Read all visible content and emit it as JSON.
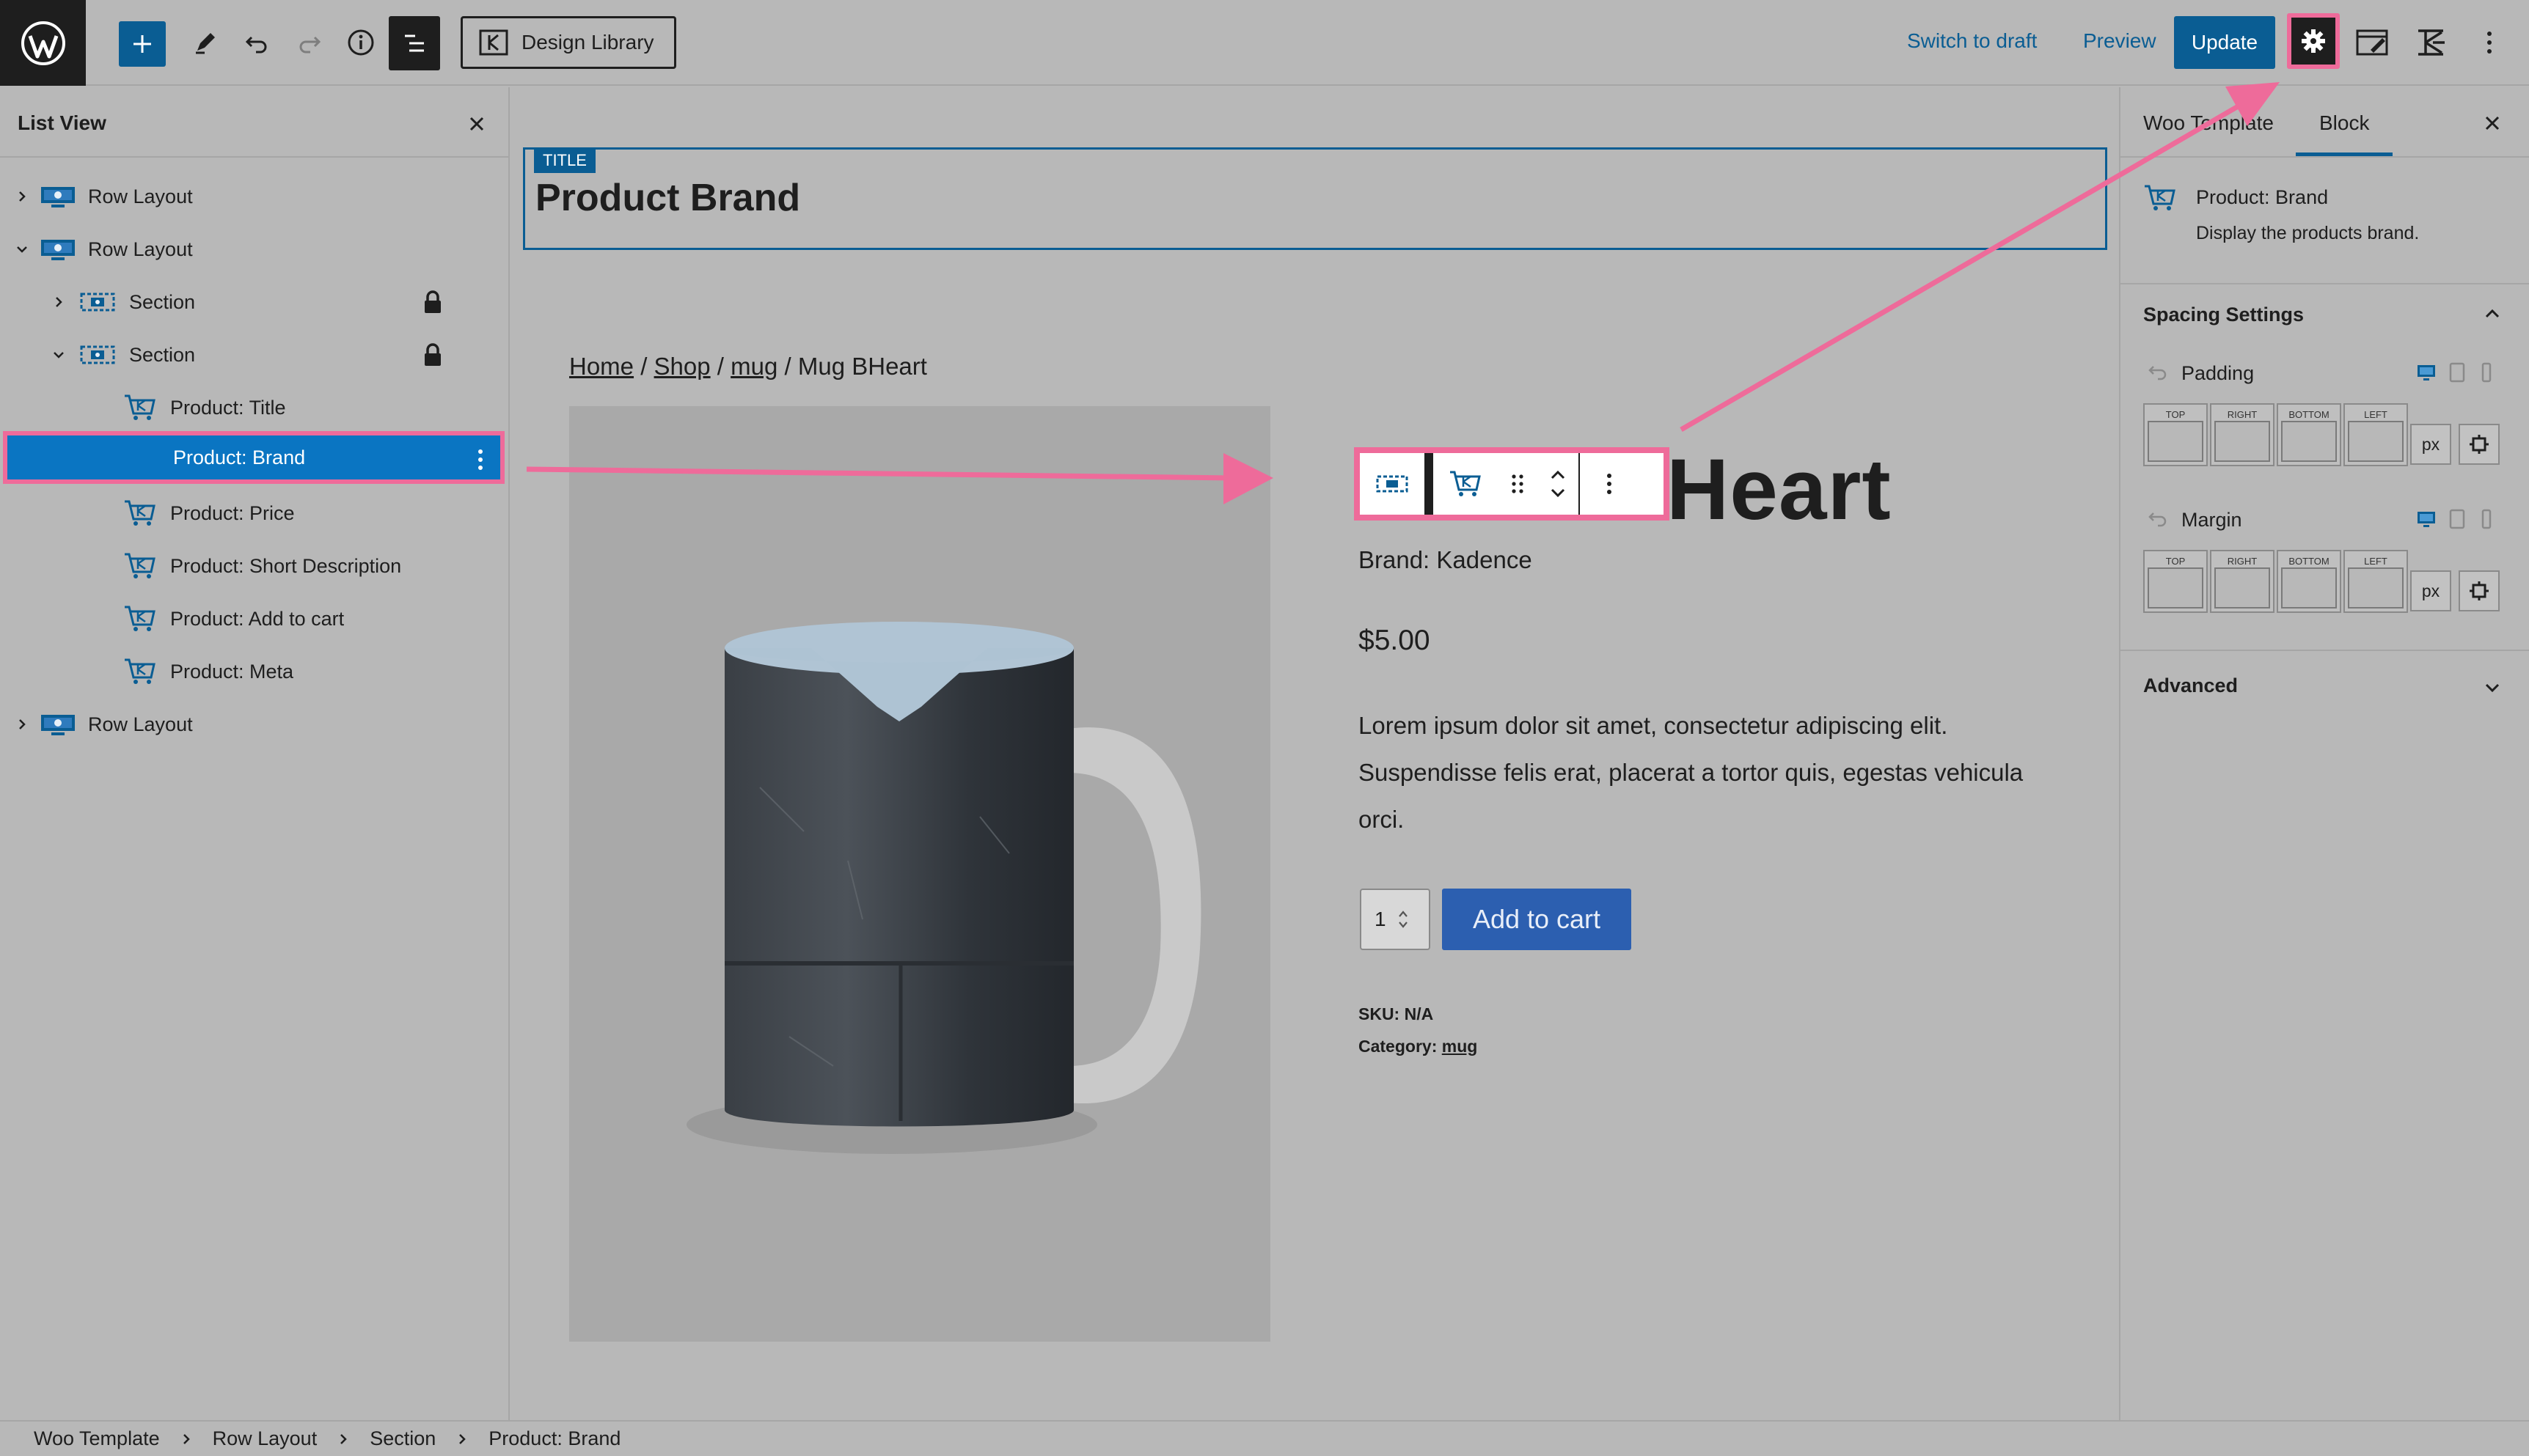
{
  "topbar": {
    "design_library_label": "Design Library",
    "switch_to_draft_label": "Switch to draft",
    "preview_label": "Preview",
    "update_label": "Update"
  },
  "list_view": {
    "title": "List View",
    "items": [
      {
        "label": "Row Layout",
        "depth": 0,
        "expanded": false,
        "icon": "row-layout-icon"
      },
      {
        "label": "Row Layout",
        "depth": 0,
        "expanded": true,
        "icon": "row-layout-icon"
      },
      {
        "label": "Section",
        "depth": 1,
        "expanded": false,
        "icon": "section-icon",
        "locked": true
      },
      {
        "label": "Section",
        "depth": 1,
        "expanded": true,
        "icon": "section-icon",
        "locked": true
      },
      {
        "label": "Product: Title",
        "depth": 2,
        "icon": "cart-icon"
      },
      {
        "label": "Product: Brand",
        "depth": 2,
        "icon": "cart-icon",
        "selected": true
      },
      {
        "label": "Product: Price",
        "depth": 2,
        "icon": "cart-icon"
      },
      {
        "label": "Product: Short Description",
        "depth": 2,
        "icon": "cart-icon"
      },
      {
        "label": "Product: Add to cart",
        "depth": 2,
        "icon": "cart-icon"
      },
      {
        "label": "Product: Meta",
        "depth": 2,
        "icon": "cart-icon"
      },
      {
        "label": "Row Layout",
        "depth": 0,
        "expanded": false,
        "icon": "row-layout-icon"
      }
    ]
  },
  "canvas": {
    "title_badge": "TITLE",
    "title_text": "Product Brand",
    "breadcrumb": {
      "home": "Home",
      "shop": "Shop",
      "category": "mug",
      "current": "Mug BHeart",
      "separator": " / "
    },
    "product_heading_visible": "Heart",
    "brand_line": "Brand: Kadence",
    "price": "$5.00",
    "description": "Lorem ipsum dolor sit amet, consectetur adipiscing elit. Suspendisse felis erat, placerat a tortor quis, egestas vehicula orci.",
    "quantity": "1",
    "add_to_cart_label": "Add to cart",
    "sku_line": "SKU: N/A",
    "category_label": "Category: ",
    "category_value": "mug"
  },
  "sidebar": {
    "tab_woo_template": "Woo Template",
    "tab_block": "Block",
    "block_card_title": "Product: Brand",
    "block_card_desc": "Display the products brand.",
    "spacing_title": "Spacing Settings",
    "padding_label": "Padding",
    "margin_label": "Margin",
    "side_labels": [
      "TOP",
      "RIGHT",
      "BOTTOM",
      "LEFT"
    ],
    "unit": "px",
    "advanced_title": "Advanced"
  },
  "footer": {
    "crumbs": [
      "Woo Template",
      "Row Layout",
      "Section",
      "Product: Brand"
    ]
  },
  "colors": {
    "accent": "#0a5d93",
    "selected": "#0a75c2",
    "highlight": "#ee6b9a",
    "button": "#2c5fb0"
  }
}
